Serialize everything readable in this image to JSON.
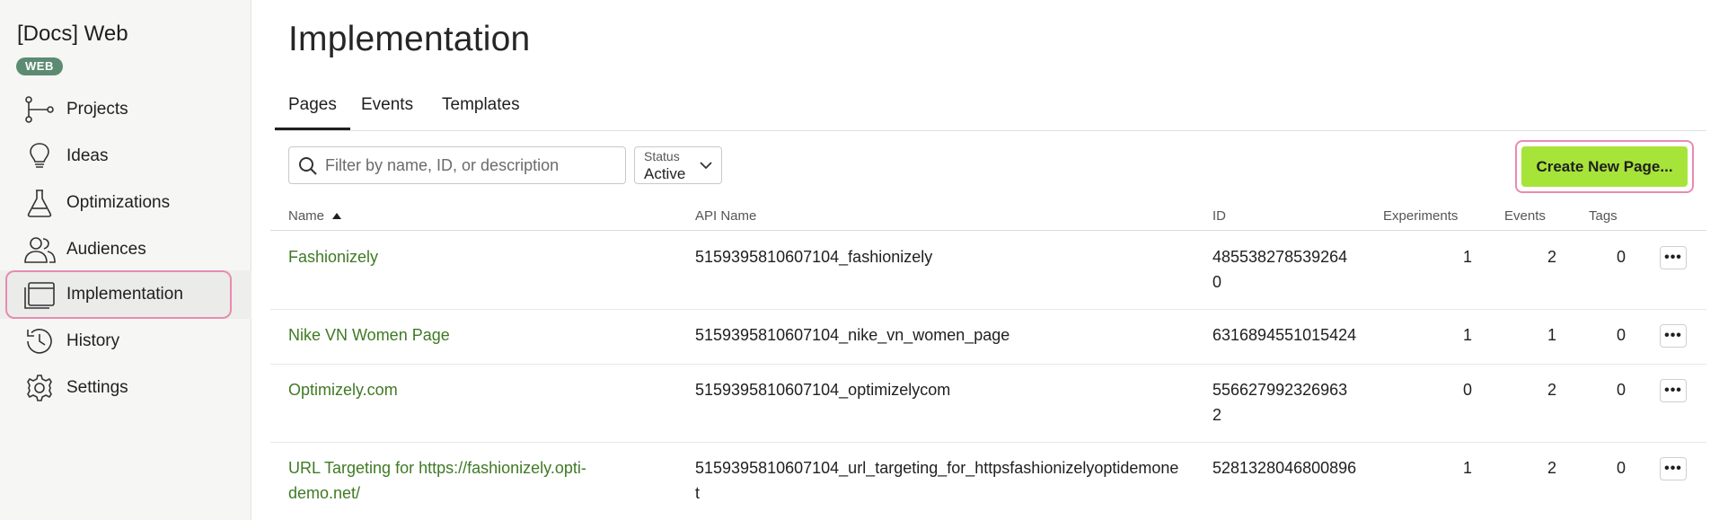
{
  "sidebar": {
    "project_title": "[Docs] Web",
    "badge": "WEB",
    "items": [
      {
        "label": "Projects",
        "icon": "projects-icon"
      },
      {
        "label": "Ideas",
        "icon": "lightbulb-icon"
      },
      {
        "label": "Optimizations",
        "icon": "flask-icon"
      },
      {
        "label": "Audiences",
        "icon": "users-icon"
      },
      {
        "label": "Implementation",
        "icon": "browser-window-icon",
        "active": true
      },
      {
        "label": "History",
        "icon": "history-icon"
      },
      {
        "label": "Settings",
        "icon": "gear-icon"
      }
    ]
  },
  "main": {
    "title": "Implementation",
    "tabs": [
      {
        "label": "Pages",
        "active": true
      },
      {
        "label": "Events"
      },
      {
        "label": "Templates"
      }
    ],
    "search": {
      "placeholder": "Filter by name, ID, or description",
      "value": ""
    },
    "status": {
      "label": "Status",
      "value": "Active"
    },
    "create_button": "Create New Page..."
  },
  "table": {
    "columns": [
      "Name",
      "API Name",
      "ID",
      "Experiments",
      "Events",
      "Tags"
    ],
    "sort_column": "Name",
    "sort_direction": "ascending",
    "rows": [
      {
        "name_line1": "Fashionizely",
        "name_line2": "",
        "api_line1": "5159395810607104_fashionizely",
        "api_line2": "",
        "id_line1": "485538278539264",
        "id_line2": "0",
        "experiments": "1",
        "events": "2",
        "tags": "0"
      },
      {
        "name_line1": "Nike VN Women Page",
        "name_line2": "",
        "api_line1": "5159395810607104_nike_vn_women_page",
        "api_line2": "",
        "id_line1": "6316894551015424",
        "id_line2": "",
        "experiments": "1",
        "events": "1",
        "tags": "0"
      },
      {
        "name_line1": "Optimizely.com",
        "name_line2": "",
        "api_line1": "5159395810607104_optimizelycom",
        "api_line2": "",
        "id_line1": "556627992326963",
        "id_line2": "2",
        "experiments": "0",
        "events": "2",
        "tags": "0"
      },
      {
        "name_line1": "URL Targeting for https://fashionizely.opti-",
        "name_line2": "demo.net/",
        "api_line1": "5159395810607104_url_targeting_for_httpsfashionizelyoptidemone",
        "api_line2": "t",
        "id_line1": "5281328046800896",
        "id_line2": "",
        "experiments": "1",
        "events": "2",
        "tags": "0"
      }
    ]
  },
  "colors": {
    "accent_green": "#a7e43a",
    "link_green": "#3f7a24",
    "badge_green": "#5d8b72",
    "highlight_pink": "#e88bb1"
  }
}
